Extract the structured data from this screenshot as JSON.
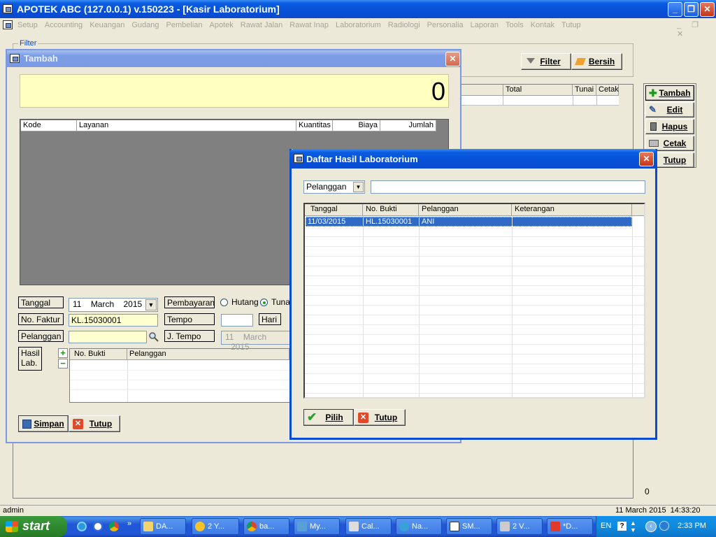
{
  "main_window": {
    "title": "APOTEK ABC (127.0.0.1) v.150223 - [Kasir Laboratorium]",
    "menu": [
      "Setup",
      "Accounting",
      "Keuangan",
      "Gudang",
      "Pembelian",
      "Apotek",
      "Rawat Jalan",
      "Rawat Inap",
      "Laboratorium",
      "Radiologi",
      "Personalia",
      "Laporan",
      "Tools",
      "Kontak",
      "Tutup"
    ],
    "filter_group_label": "Filter",
    "filter_button": "Filter",
    "bersih_button": "Bersih",
    "back_grid_headers": [
      "Total",
      "Tunai",
      "Cetak"
    ],
    "side_buttons": [
      "Tambah",
      "Edit",
      "Hapus",
      "Cetak",
      "Tutup"
    ],
    "count_value": "0"
  },
  "tambah_dialog": {
    "title": "Tambah",
    "total_display": "0",
    "grid_headers": [
      "Kode",
      "Layanan",
      "Kuantitas",
      "Biaya",
      "Jumlah"
    ],
    "labels": {
      "tanggal": "Tanggal",
      "no_faktur": "No. Faktur",
      "pelanggan": "Pelanggan",
      "hasil_lab": "Hasil Lab.",
      "pembayaran": "Pembayaran",
      "tempo": "Tempo",
      "j_tempo": "J. Tempo",
      "hari": "Hari"
    },
    "date": {
      "day": "11",
      "month": "March",
      "year": "2015"
    },
    "no_faktur_value": "KL.15030001",
    "pelanggan_value": "",
    "payment_options": [
      "Hutang",
      "Tunai"
    ],
    "payment_selected": "Tunai",
    "tempo_value": "",
    "jtempo_date": {
      "day": "11",
      "month": "March",
      "year": "2015"
    },
    "hasil_grid_headers": [
      "No. Bukti",
      "Pelanggan"
    ],
    "simpan_button": "Simpan",
    "tutup_button": "Tutup"
  },
  "daftar_dialog": {
    "title": "Daftar Hasil Laboratorium",
    "search_field_select": "Pelanggan",
    "search_value": "",
    "grid_headers": [
      "Tanggal",
      "No. Bukti",
      "Pelanggan",
      "Keterangan"
    ],
    "rows": [
      {
        "tanggal": "11/03/2015",
        "no_bukti": "HL.15030001",
        "pelanggan": "ANI",
        "keterangan": ""
      }
    ],
    "pilih_button": "Pilih",
    "tutup_button": "Tutup"
  },
  "status_bar": {
    "user": "admin",
    "datetime": "11 March 2015  14:33:20"
  },
  "taskbar": {
    "start_label": "start",
    "items": [
      "DA...",
      "2 Y...",
      "ba...",
      "My...",
      "Cal...",
      "Na...",
      "SM...",
      "2 V...",
      "*D..."
    ],
    "lang": "EN",
    "clock": "2:33 PM"
  }
}
